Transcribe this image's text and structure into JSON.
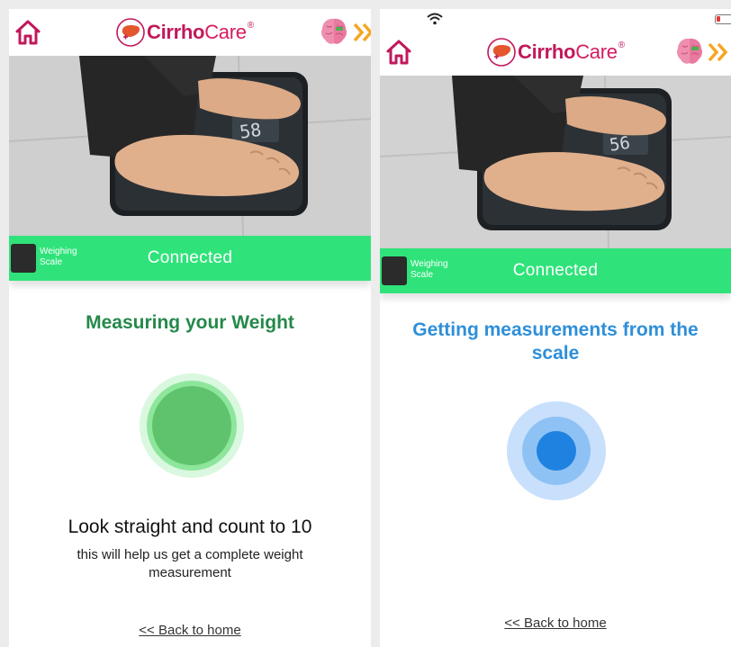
{
  "colors": {
    "brand_pink": "#c2185b",
    "status_green": "#2fe37a",
    "measuring_green": "#25894a",
    "measuring_blue": "#2f8fd8"
  },
  "icons": [
    "home-icon",
    "liver-logo-icon",
    "brain-icon",
    "chevrons-right-icon",
    "wifi-icon",
    "battery-icon"
  ],
  "screens": [
    {
      "brand": {
        "name_part1": "Cirrho",
        "name_part2": "Care",
        "reg": "®"
      },
      "device": {
        "name": "Weighing Scale",
        "status": "Connected"
      },
      "scale_display": "58",
      "headline": "Measuring your Weight",
      "instruction": "Look straight and count to 10",
      "sub_instruction": "this will help us get a complete weight measurement",
      "back_link": "<< Back to home"
    },
    {
      "brand": {
        "name_part1": "Cirrho",
        "name_part2": "Care",
        "reg": "®"
      },
      "device": {
        "name": "Weighing Scale",
        "status": "Connected"
      },
      "scale_display": "56",
      "headline": "Getting measurements from the scale",
      "back_link": "<< Back to home"
    }
  ]
}
